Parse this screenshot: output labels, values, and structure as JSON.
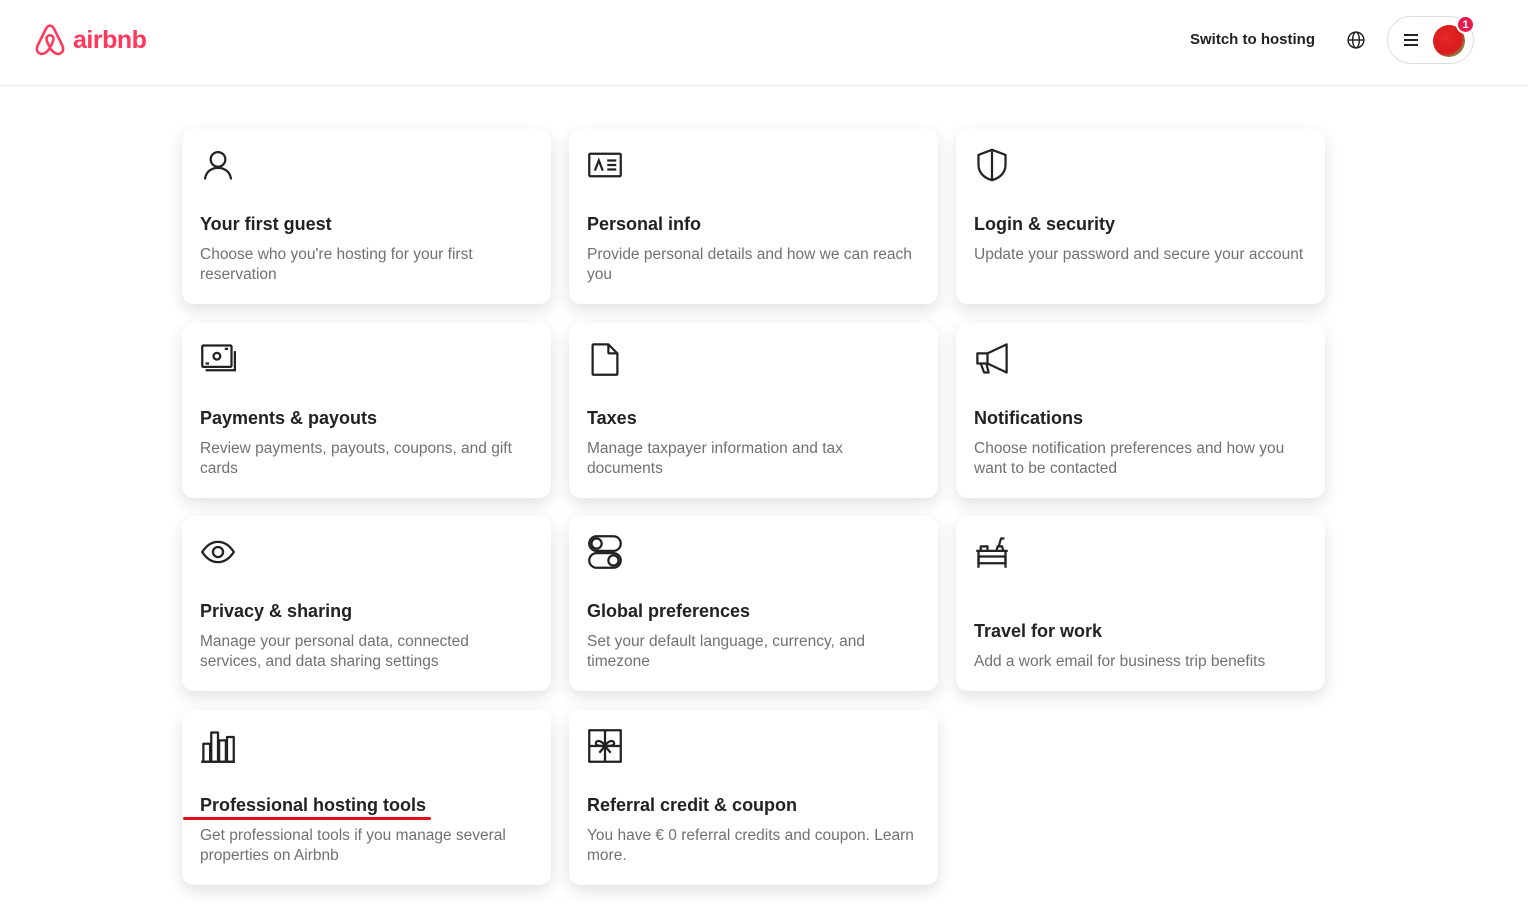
{
  "header": {
    "brand": "airbnb",
    "switch_hosting": "Switch to hosting",
    "notification_count": "1",
    "accent_color": "#FF385C"
  },
  "cards": [
    {
      "icon": "person-icon",
      "title": "Your first guest",
      "description": "Choose who you're hosting for your first reservation"
    },
    {
      "icon": "id-card-icon",
      "title": "Personal info",
      "description": "Provide personal details and how we can reach you"
    },
    {
      "icon": "shield-icon",
      "title": "Login & security",
      "description": "Update your password and secure your account"
    },
    {
      "icon": "money-icon",
      "title": "Payments & payouts",
      "description": "Review payments, payouts, coupons, and gift cards"
    },
    {
      "icon": "document-icon",
      "title": "Taxes",
      "description": "Manage taxpayer information and tax documents"
    },
    {
      "icon": "megaphone-icon",
      "title": "Notifications",
      "description": "Choose notification preferences and how you want to be contacted"
    },
    {
      "icon": "eye-icon",
      "title": "Privacy & sharing",
      "description": "Manage your personal data, connected services, and data sharing settings"
    },
    {
      "icon": "toggles-icon",
      "title": "Global preferences",
      "description": "Set your default language, currency, and timezone"
    },
    {
      "icon": "desk-icon",
      "title": "Travel for work",
      "description": "Add a work email for business trip benefits"
    },
    {
      "icon": "bar-chart-icon",
      "title": "Professional hosting tools",
      "description": "Get professional tools if you manage several properties on Airbnb"
    },
    {
      "icon": "gift-icon",
      "title": "Referral credit & coupon",
      "description": "You have € 0 referral credits and coupon. Learn more."
    }
  ]
}
